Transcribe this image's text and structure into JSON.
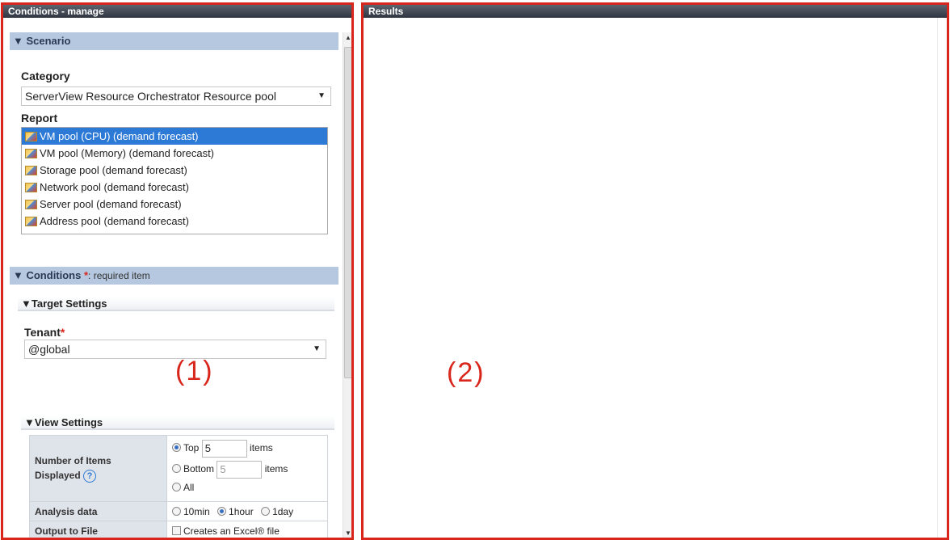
{
  "left_panel": {
    "title": "Conditions - manage",
    "overlay_label": "(1)",
    "scenario": {
      "header": "▼ Scenario",
      "category_label": "Category",
      "category_value": "ServerView Resource Orchestrator Resource pool",
      "report_label": "Report",
      "reports": [
        {
          "label": "VM pool (CPU) (demand forecast)",
          "selected": true
        },
        {
          "label": "VM pool (Memory) (demand forecast)",
          "selected": false
        },
        {
          "label": "Storage pool (demand forecast)",
          "selected": false
        },
        {
          "label": "Network pool (demand forecast)",
          "selected": false
        },
        {
          "label": "Server pool (demand forecast)",
          "selected": false
        },
        {
          "label": "Address pool (demand forecast)",
          "selected": false
        }
      ]
    },
    "conditions": {
      "header": "▼ Conditions",
      "required_star": "*",
      "required_text": ": required item",
      "target_settings": {
        "header": "▼Target Settings",
        "tenant_label": "Tenant",
        "tenant_star": "*",
        "tenant_value": "@global"
      },
      "view_settings": {
        "header": "▼View Settings",
        "items_label_line1": "Number of Items",
        "items_label_line2": "Displayed",
        "help_icon": "?",
        "top_label": "Top",
        "top_value": "5",
        "bottom_label": "Bottom",
        "bottom_value": "5",
        "items_unit": "items",
        "all_label": "All",
        "analysis_label": "Analysis data",
        "analysis_options": [
          "10min",
          "1hour",
          "1day"
        ],
        "analysis_selected": "1hour",
        "output_label": "Output to File",
        "output_option": "Creates an Excel® file"
      }
    }
  },
  "right_panel": {
    "title": "Results",
    "overlay_label": "(2)"
  },
  "colors": {
    "highlight_border": "#d9261c",
    "section_header_bg": "#b6c8df",
    "selected_row": "#2d7ad6"
  }
}
